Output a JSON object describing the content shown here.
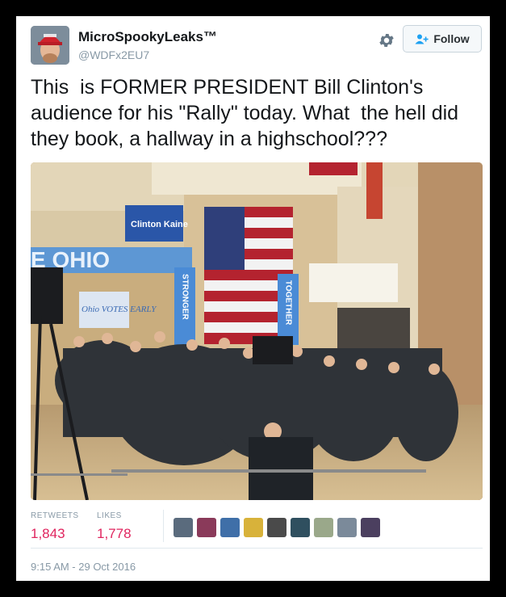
{
  "user": {
    "display_name": "MicroSpookyLeaks™",
    "handle": "@WDFx2EU7"
  },
  "header": {
    "follow_label": "Follow"
  },
  "tweet": {
    "text": "This  is FORMER PRESIDENT Bill Clinton's audience for his \"Rally\" today. What  the hell did they book, a hallway in a highschool???"
  },
  "photo": {
    "banner_left": "E OHIO",
    "sign_text": "Clinton Kaine",
    "vertical_left": "STRONGER",
    "vertical_right": "TOGETHER",
    "poster_text": "Ohio VOTES EARLY"
  },
  "stats": {
    "retweets_label": "RETWEETS",
    "retweets_value": "1,843",
    "likes_label": "LIKES",
    "likes_value": "1,778"
  },
  "likers": [
    "#5a6b7d",
    "#8a3a5a",
    "#3f6fa8",
    "#d8b23a",
    "#4a4a4a",
    "#2f4f5f",
    "#9aa88a",
    "#7b8a9a",
    "#4b3f5f"
  ],
  "timestamp": "9:15 AM - 29 Oct 2016",
  "colors": {
    "like_accent": "#e0245e",
    "meta_gray": "#8899a6"
  }
}
